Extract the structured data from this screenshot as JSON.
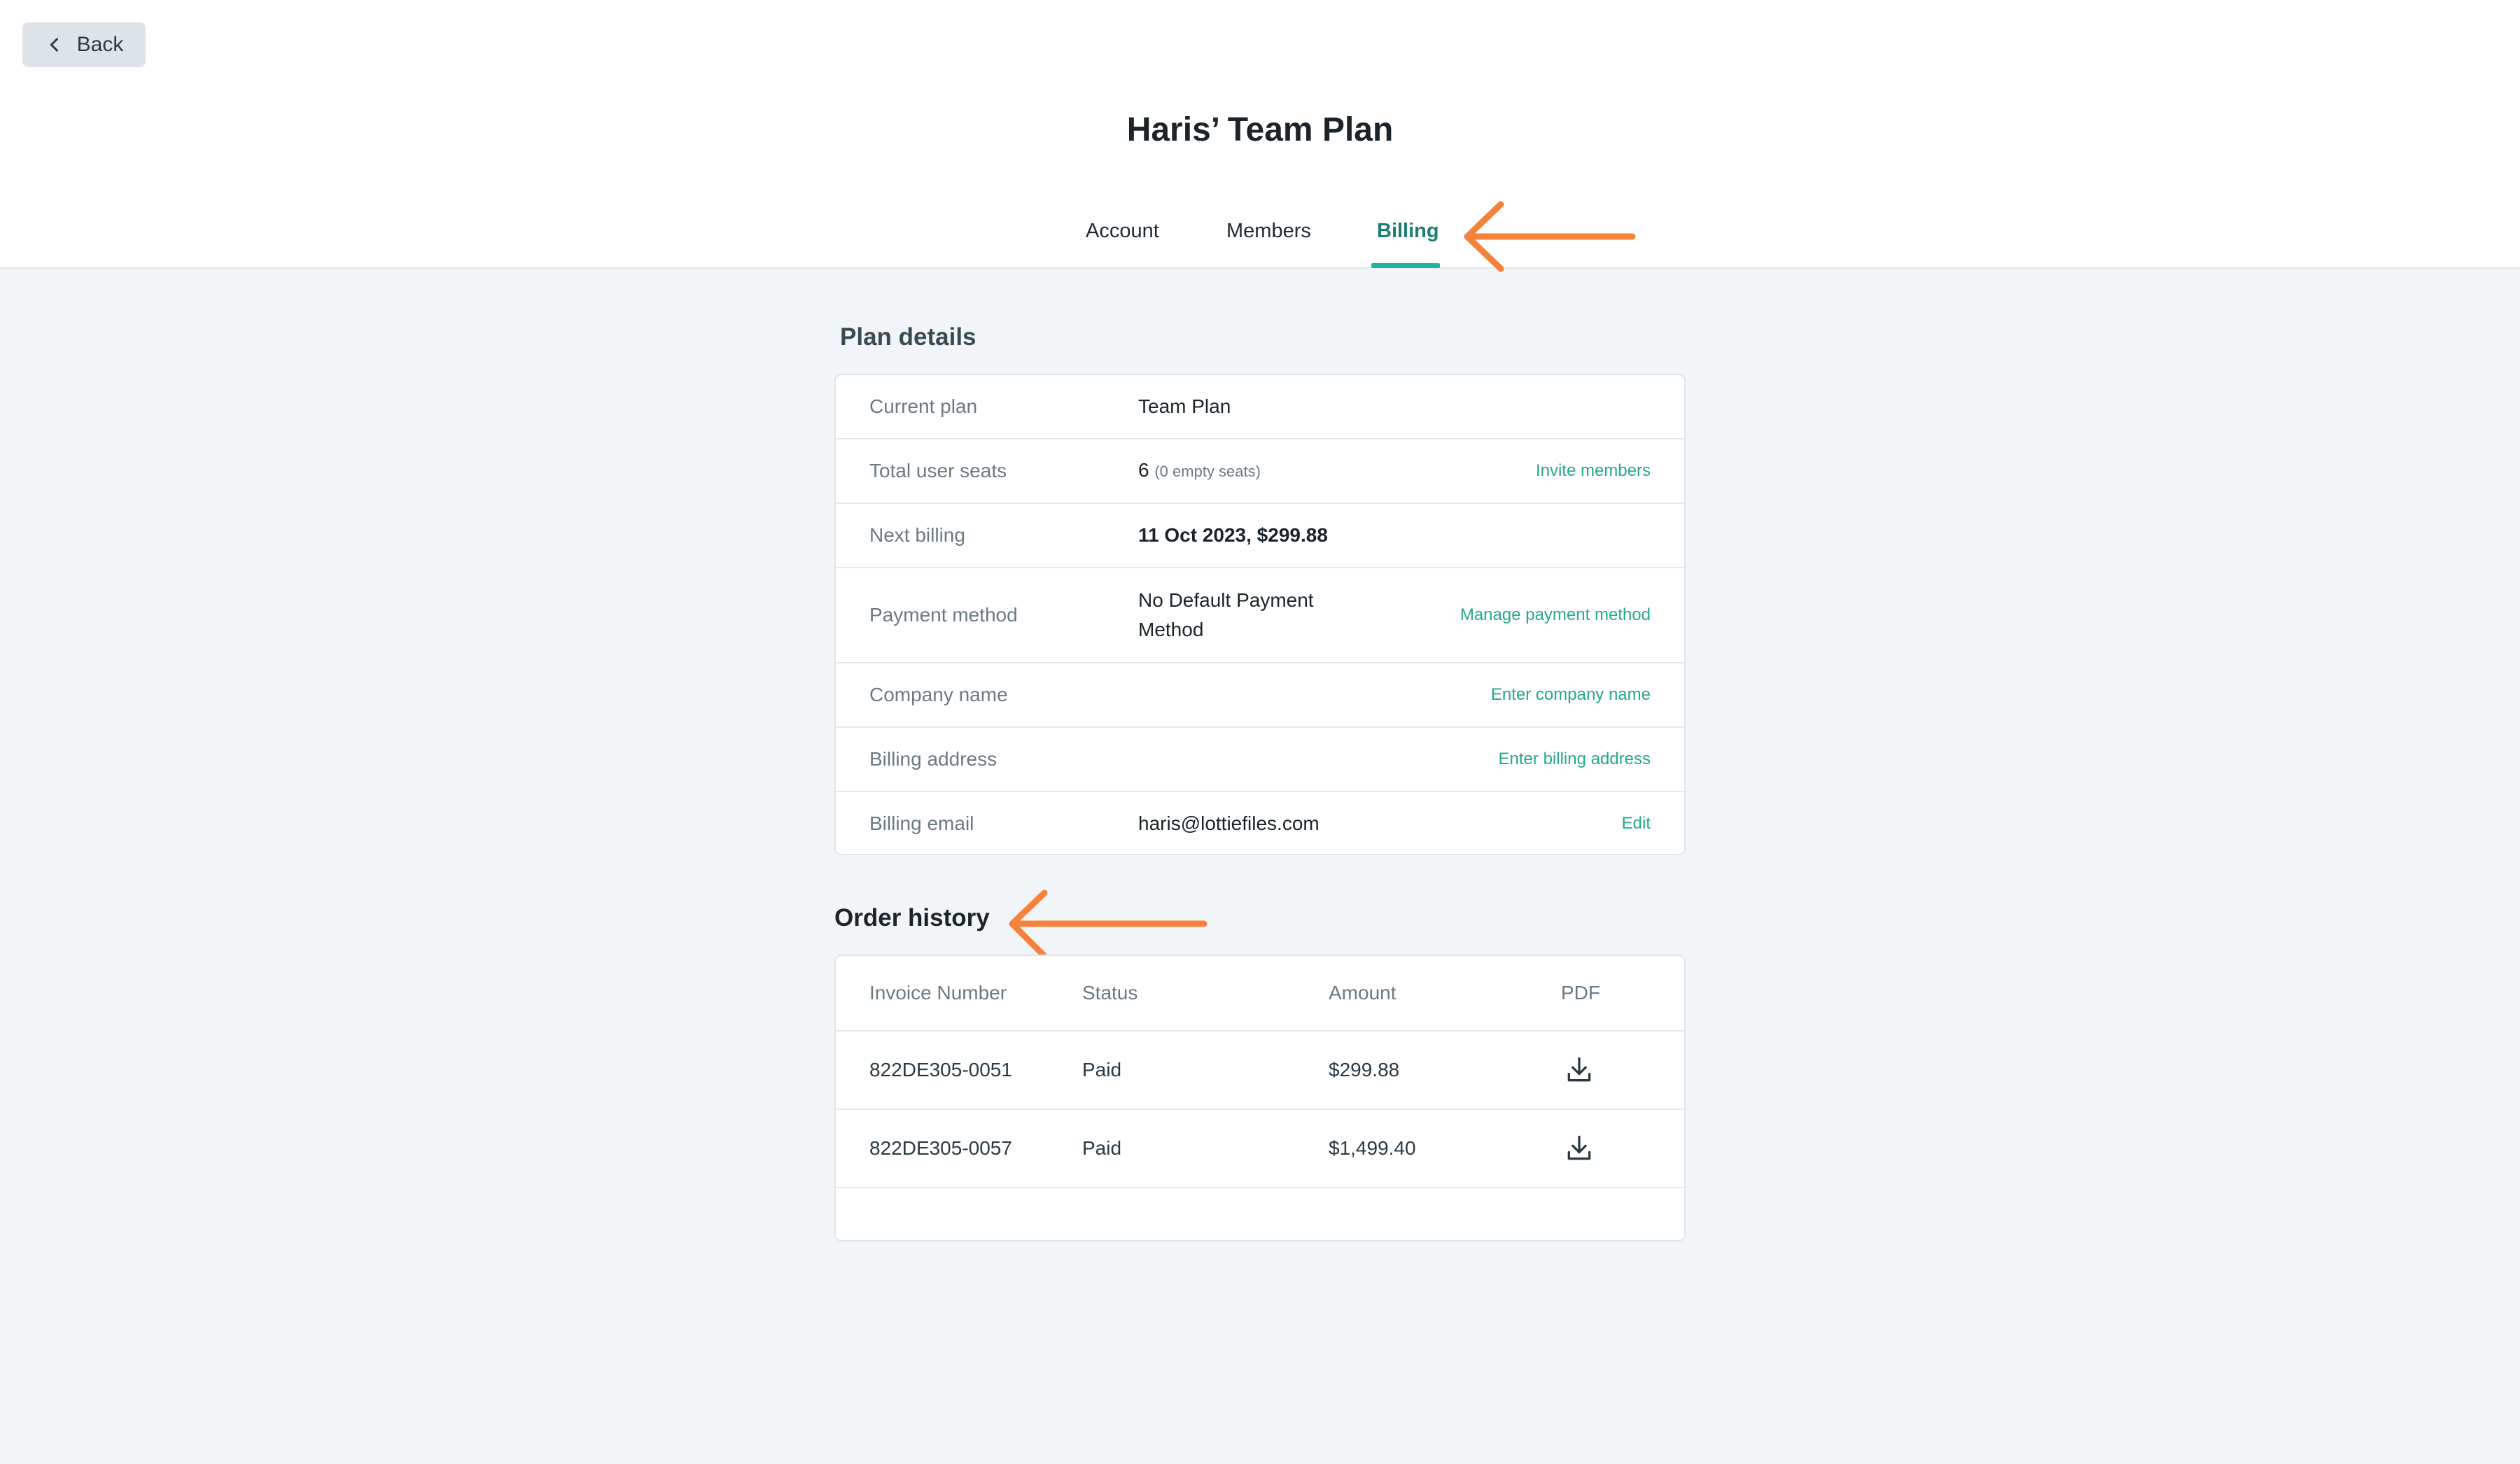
{
  "header": {
    "back_label": "Back",
    "title": "Haris’ Team Plan"
  },
  "tabs": [
    {
      "label": "Account",
      "active": false
    },
    {
      "label": "Members",
      "active": false
    },
    {
      "label": "Billing",
      "active": true
    }
  ],
  "plan_details": {
    "title": "Plan details",
    "rows": [
      {
        "label": "Current plan",
        "value": "Team Plan",
        "action": ""
      },
      {
        "label": "Total user seats",
        "value": "6",
        "value_note": "(0 empty seats)",
        "action": "Invite members"
      },
      {
        "label": "Next billing",
        "value": "11 Oct 2023, $299.88",
        "action": ""
      },
      {
        "label": "Payment method",
        "value_line1": "No Default Payment",
        "value_line2": "Method",
        "action": "Manage payment method"
      },
      {
        "label": "Company name",
        "value": "",
        "action": "Enter company name"
      },
      {
        "label": "Billing address",
        "value": "",
        "action": "Enter billing address"
      },
      {
        "label": "Billing email",
        "value": "haris@lottiefiles.com",
        "action": "Edit"
      }
    ]
  },
  "order_history": {
    "title": "Order history",
    "columns": [
      "Invoice Number",
      "Status",
      "Amount",
      "PDF"
    ],
    "rows": [
      {
        "invoice": "822DE305-0051",
        "status": "Paid",
        "amount": "$299.88"
      },
      {
        "invoice": "822DE305-0057",
        "status": "Paid",
        "amount": "$1,499.40"
      }
    ]
  },
  "colors": {
    "accent": "#24a88d",
    "active_tab": "#1f7d73",
    "annotation_arrow": "#f5823a",
    "background": "#f2f5f7"
  },
  "icons": {
    "back": "chevron-left-icon",
    "pdf": "download-icon",
    "annotation": "arrow-left-icon"
  }
}
